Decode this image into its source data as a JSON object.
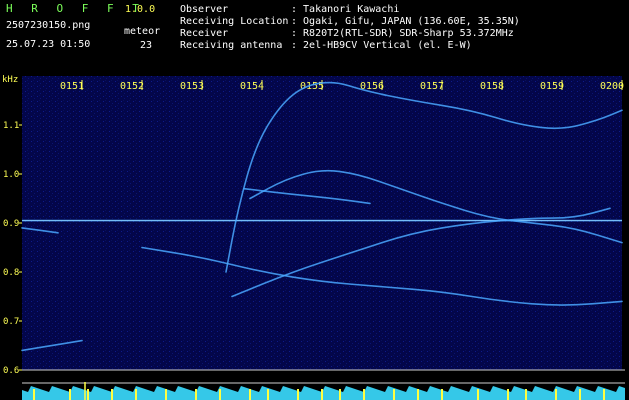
{
  "header": {
    "app_title": "H R O F F T",
    "app_version": "1.0.0",
    "file_name": "2507230150.png",
    "timestamp": "25.07.23 01:50",
    "meteor_label": "meteor",
    "meteor_count": "23",
    "info": [
      {
        "label": "Observer",
        "value": ": Takanori Kawachi"
      },
      {
        "label": "Receiving Location",
        "value": ": Ogaki, Gifu, JAPAN (136.60E, 35.35N)"
      },
      {
        "label": "Receiver",
        "value": ": R820T2(RTL-SDR) SDR-Sharp 53.372MHz"
      },
      {
        "label": "Receiving antenna",
        "value": ": 2el-HB9CV Vertical (el. E-W)"
      }
    ]
  },
  "colors": {
    "background": "#000000",
    "spectrogram_bg": "#03064a",
    "axis_text": "#ffff55",
    "header_green": "#7cff5a",
    "signal": "#4aa8ff",
    "signal_bright": "#b8ecff",
    "power_trace": "#35c8e8",
    "power_spike": "#ffff40"
  },
  "chart_data": {
    "type": "heatmap",
    "y_unit": "kHz",
    "x_ticks": [
      "0151",
      "0152",
      "0153",
      "0154",
      "0155",
      "0156",
      "0157",
      "0158",
      "0159",
      "0200"
    ],
    "y_ticks": [
      "1.1",
      "1.0",
      "0.9",
      "0.8",
      "0.7",
      "0.6"
    ],
    "x_range_minutes": [
      50,
      60
    ],
    "y_range_khz": [
      0.6,
      1.2
    ],
    "carrier_khz": 0.905,
    "traces": [
      {
        "name": "",
        "points": [
          [
            50.0,
            0.89
          ],
          [
            50.6,
            0.88
          ]
        ]
      },
      {
        "name": "",
        "points": [
          [
            53.4,
            0.8
          ],
          [
            53.6,
            0.93
          ],
          [
            53.9,
            1.06
          ],
          [
            54.3,
            1.14
          ],
          [
            54.7,
            1.18
          ],
          [
            55.2,
            1.19
          ],
          [
            55.7,
            1.17
          ],
          [
            56.5,
            1.15
          ],
          [
            57.5,
            1.13
          ],
          [
            58.3,
            1.1
          ],
          [
            59.0,
            1.09
          ],
          [
            59.6,
            1.11
          ],
          [
            60.0,
            1.13
          ]
        ]
      },
      {
        "name": "",
        "points": [
          [
            53.8,
            0.95
          ],
          [
            54.4,
            0.99
          ],
          [
            55.0,
            1.01
          ],
          [
            55.6,
            1.0
          ],
          [
            56.3,
            0.97
          ],
          [
            57.0,
            0.94
          ],
          [
            57.8,
            0.91
          ],
          [
            58.5,
            0.9
          ],
          [
            59.2,
            0.89
          ],
          [
            60.0,
            0.86
          ]
        ]
      },
      {
        "name": "",
        "points": [
          [
            53.5,
            0.75
          ],
          [
            54.5,
            0.8
          ],
          [
            55.5,
            0.84
          ],
          [
            56.5,
            0.88
          ],
          [
            57.5,
            0.9
          ],
          [
            58.5,
            0.91
          ],
          [
            59.2,
            0.91
          ],
          [
            59.8,
            0.93
          ]
        ]
      },
      {
        "name": "",
        "points": [
          [
            52.0,
            0.85
          ],
          [
            53.0,
            0.83
          ],
          [
            54.0,
            0.8
          ],
          [
            55.0,
            0.78
          ],
          [
            56.0,
            0.77
          ],
          [
            57.0,
            0.76
          ],
          [
            58.0,
            0.74
          ],
          [
            59.0,
            0.73
          ],
          [
            60.0,
            0.74
          ]
        ]
      },
      {
        "name": "",
        "points": [
          [
            50.0,
            0.64
          ],
          [
            50.5,
            0.65
          ],
          [
            51.0,
            0.66
          ]
        ]
      },
      {
        "name": "",
        "points": [
          [
            53.7,
            0.97
          ],
          [
            54.4,
            0.96
          ],
          [
            55.2,
            0.95
          ],
          [
            55.8,
            0.94
          ]
        ]
      }
    ],
    "meteor_echoes_minutes": [
      50.2,
      50.8,
      51.1,
      51.5,
      51.9,
      52.4,
      52.9,
      53.3,
      53.8,
      54.1,
      54.6,
      55.0,
      55.3,
      55.7,
      56.2,
      56.6,
      57.0,
      57.6,
      58.1,
      58.4,
      58.9,
      59.3,
      59.7
    ]
  }
}
